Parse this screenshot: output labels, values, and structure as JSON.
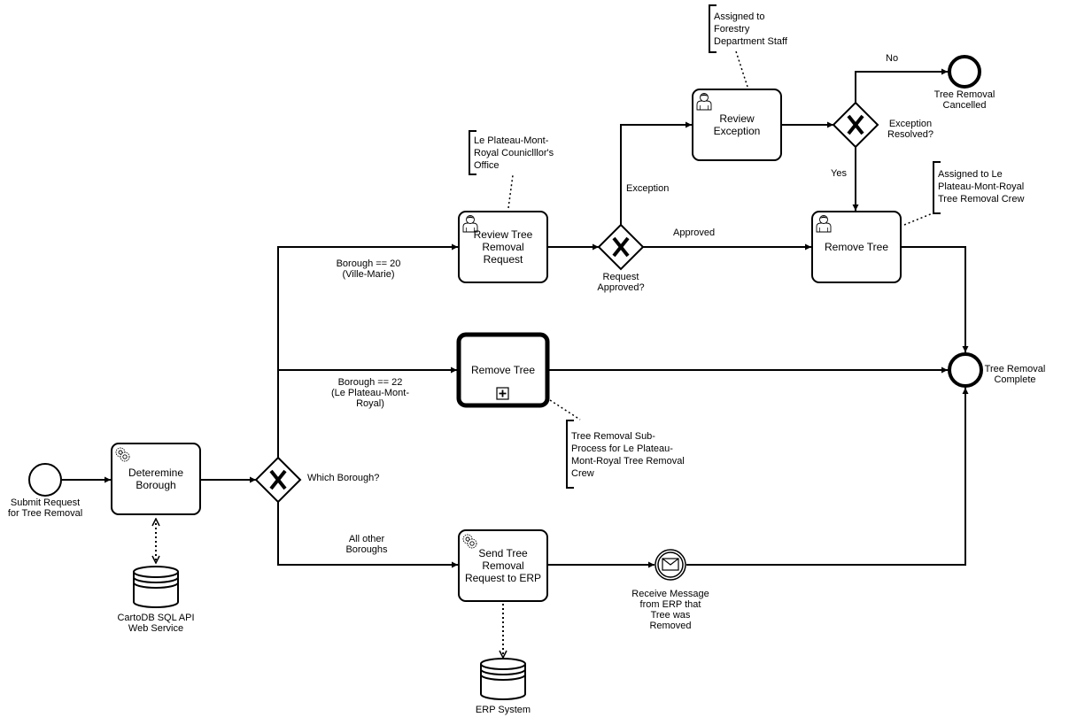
{
  "diagram": {
    "type": "BPMN process",
    "start_event": {
      "label_lines": [
        "Submit Request",
        "for Tree Removal"
      ]
    },
    "tasks": {
      "determine_borough": {
        "kind": "service",
        "label_lines": [
          "Deteremine",
          "Borough"
        ]
      },
      "review_request": {
        "kind": "user",
        "label_lines": [
          "Review Tree",
          "Removal",
          "Request"
        ]
      },
      "review_exception": {
        "kind": "user",
        "label_lines": [
          "Review",
          "Exception"
        ]
      },
      "remove_tree_user": {
        "kind": "user",
        "label_lines": [
          "Remove Tree"
        ]
      },
      "remove_tree_subprocess": {
        "kind": "collapsed-subprocess",
        "label_lines": [
          "Remove Tree"
        ]
      },
      "send_to_erp": {
        "kind": "service",
        "label_lines": [
          "Send Tree",
          "Removal",
          "Request to ERP"
        ]
      }
    },
    "gateways": {
      "which_borough": {
        "label": "Which Borough?"
      },
      "request_approved": {
        "label_lines": [
          "Request",
          "Approved?"
        ]
      },
      "exception_resolved": {
        "label_lines": [
          "Exception",
          "Resolved?"
        ]
      }
    },
    "events": {
      "receive_message": {
        "kind": "message-intermediate-catch",
        "label_lines": [
          "Receive Message",
          "from ERP that",
          "Tree was",
          "Removed"
        ]
      },
      "end_cancelled": {
        "label_lines": [
          "Tree Removal",
          "Cancelled"
        ]
      },
      "end_complete": {
        "label_lines": [
          "Tree Removal",
          "Complete"
        ]
      }
    },
    "flow_labels": {
      "borough_20": [
        "Borough == 20",
        "(Ville-Marie)"
      ],
      "borough_22": [
        "Borough == 22",
        "(Le Plateau-Mont-",
        "Royal)"
      ],
      "all_other": [
        "All other",
        "Boroughs"
      ],
      "exception": "Exception",
      "approved": "Approved",
      "no": "No",
      "yes": "Yes"
    },
    "data_stores": {
      "cartodb": {
        "label_lines": [
          "CartoDB SQL API",
          "Web Service"
        ]
      },
      "erp": {
        "label_lines": [
          "ERP System"
        ]
      }
    },
    "annotations": {
      "councillor": [
        "Le Plateau-Mont-",
        "Royal Couniclllor's",
        "Office"
      ],
      "forestry": [
        "Assigned to",
        "Forestry",
        "Department Staff"
      ],
      "crew": [
        "Assigned to Le",
        "Plateau-Mont-Royal",
        "Tree Removal Crew"
      ],
      "subprocess": [
        "Tree Removal Sub-",
        "Process for Le Plateau-",
        "Mont-Royal Tree Removal",
        "Crew"
      ]
    }
  }
}
